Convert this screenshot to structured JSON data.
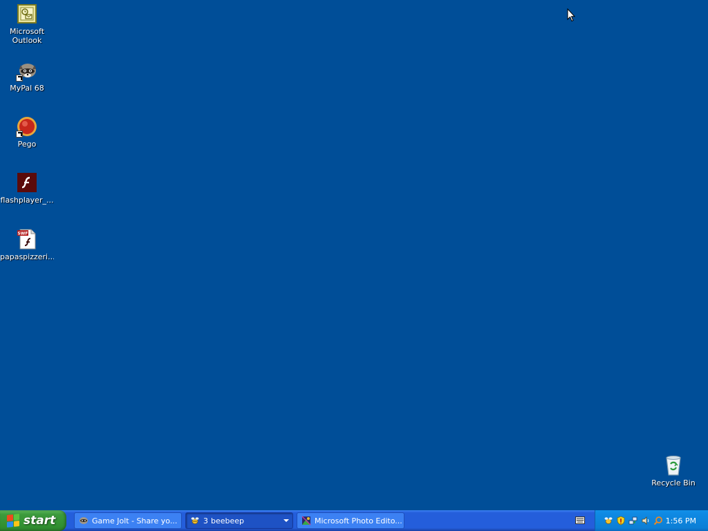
{
  "desktop": {
    "background_color": "#004e98",
    "icons": [
      {
        "label": "Microsoft\nOutlook",
        "icon": "outlook-icon"
      },
      {
        "label": "MyPal 68",
        "icon": "mypal-raccoon-icon"
      },
      {
        "label": "Pego",
        "icon": "pego-icon"
      },
      {
        "label": "flashplayer_...",
        "icon": "flash-player-icon"
      },
      {
        "label": "papaspizzeri...",
        "icon": "swf-file-icon"
      },
      {
        "label": "Recycle Bin",
        "icon": "recycle-bin-icon"
      }
    ]
  },
  "taskbar": {
    "start_label": "start",
    "tasks": [
      {
        "label": "Game Jolt - Share yo...",
        "icon": "mypal-raccoon-icon"
      },
      {
        "count": "3",
        "label": "beebeep",
        "icon": "beebeep-icon"
      },
      {
        "label": "Microsoft Photo Edito...",
        "icon": "photo-editor-icon"
      }
    ],
    "tray": {
      "icons": [
        "beebeep-tray-icon",
        "security-shield-icon",
        "network-icon",
        "volume-icon",
        "search-tray-icon"
      ],
      "clock": "1:56 PM"
    },
    "colors": {
      "taskbar": "#245edb",
      "start": "#3c9a3c",
      "tray": "#0c7fd6"
    }
  }
}
